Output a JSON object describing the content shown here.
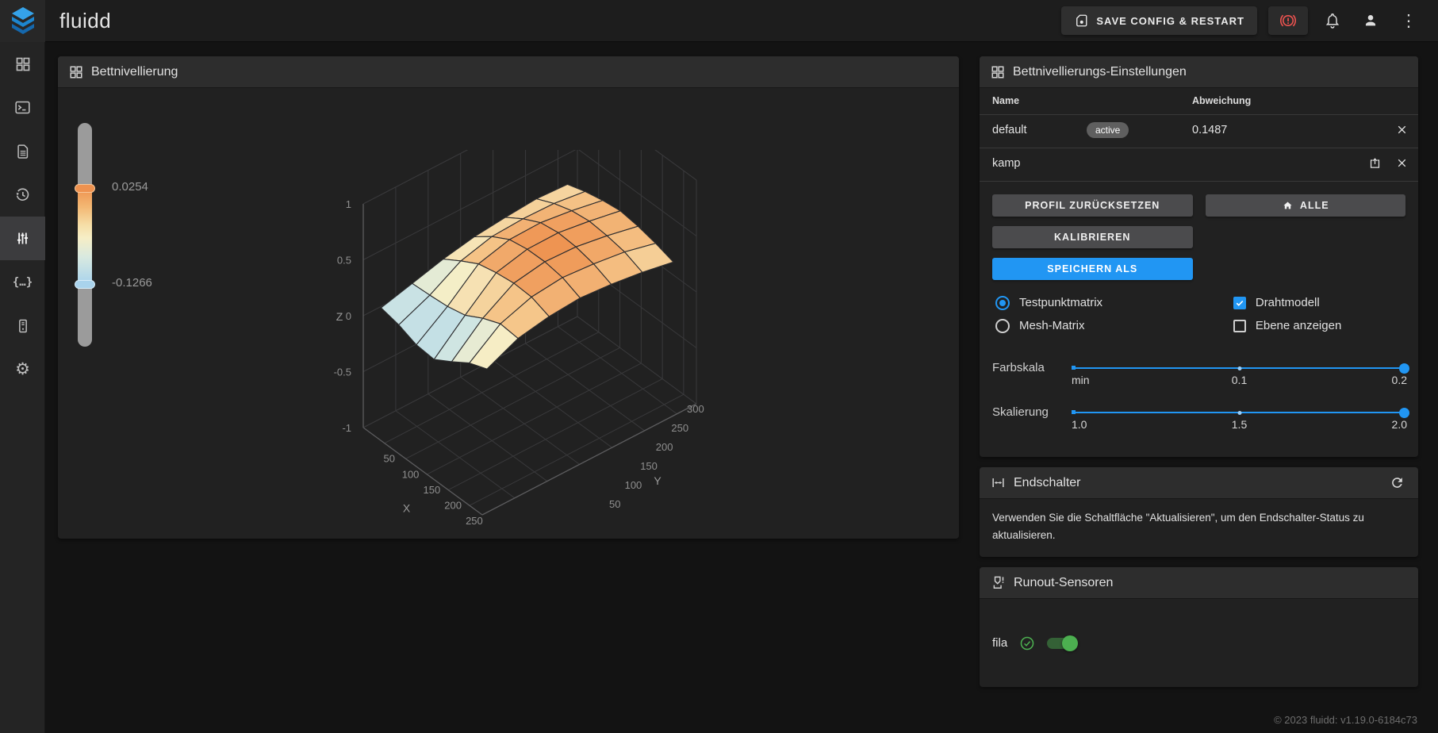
{
  "topbar": {
    "app_title": "fluidd",
    "save_button": "SAVE CONFIG & RESTART"
  },
  "sidebar": {
    "items": [
      {
        "name": "dashboard",
        "active": false
      },
      {
        "name": "console",
        "active": false
      },
      {
        "name": "jobs",
        "active": false
      },
      {
        "name": "history",
        "active": false
      },
      {
        "name": "tune",
        "active": true
      },
      {
        "name": "macros",
        "active": false
      },
      {
        "name": "hardware",
        "active": false
      },
      {
        "name": "settings",
        "active": false
      }
    ]
  },
  "bed_mesh_panel": {
    "title": "Bettnivellierung",
    "colorbar": {
      "max_label": "0.0254",
      "min_label": "-0.1266"
    }
  },
  "chart_data": {
    "type": "surface",
    "title": "bed mesh height map",
    "xlabel": "X",
    "ylabel": "Y",
    "zlabel": "Z",
    "x_range": [
      0,
      280
    ],
    "y_range": [
      0,
      330
    ],
    "z_range": [
      -1,
      1
    ],
    "x_ticks": [
      "50",
      "100",
      "150",
      "200",
      "250"
    ],
    "x_tick_values": [
      50,
      100,
      150,
      200,
      250
    ],
    "y_ticks": [
      "50",
      "100",
      "150",
      "200",
      "250",
      "300"
    ],
    "y_tick_values": [
      50,
      100,
      150,
      200,
      250,
      300
    ],
    "z_ticks": [
      "1",
      "0.5",
      "0",
      "-0.5",
      "-1"
    ],
    "z_tick_values": [
      1,
      0.5,
      0,
      -0.5,
      -1
    ],
    "value_min": -0.1266,
    "value_max": 0.0254,
    "colorscale": [
      [
        0,
        "#a9d3ec"
      ],
      [
        0.38,
        "#d8e9e0"
      ],
      [
        0.56,
        "#f6eec6"
      ],
      [
        0.78,
        "#f5c68a"
      ],
      [
        1,
        "#ee9250"
      ]
    ],
    "mesh_z": [
      [
        -0.095,
        -0.105,
        -0.122,
        -0.126,
        -0.1,
        -0.072,
        -0.055
      ],
      [
        -0.075,
        -0.072,
        -0.068,
        -0.058,
        -0.034,
        -0.016,
        -0.02
      ],
      [
        -0.055,
        -0.028,
        -0.004,
        0.006,
        0.012,
        0.01,
        -0.006
      ],
      [
        -0.04,
        -0.008,
        0.016,
        0.024,
        0.025,
        0.018,
        0.0
      ],
      [
        -0.032,
        -0.004,
        0.018,
        0.025,
        0.022,
        0.012,
        -0.006
      ],
      [
        -0.026,
        -0.006,
        0.008,
        0.014,
        0.01,
        0.002,
        -0.016
      ],
      [
        -0.03,
        -0.016,
        -0.006,
        0.0,
        -0.006,
        -0.016,
        -0.03
      ]
    ]
  },
  "settings_panel": {
    "title": "Bettnivellierungs-Einstellungen",
    "table": {
      "col_name": "Name",
      "col_deviation": "Abweichung",
      "rows": [
        {
          "name": "default",
          "badge": "active",
          "deviation": "0.1487"
        },
        {
          "name": "kamp",
          "badge": "",
          "deviation": ""
        }
      ]
    },
    "buttons": {
      "reset": "PROFIL ZURÜCKSETZEN",
      "home_all": "ALLE",
      "calibrate": "KALIBRIEREN",
      "save_as": "SPEICHERN ALS"
    },
    "radios": [
      {
        "label": "Testpunktmatrix",
        "selected": true
      },
      {
        "label": "Mesh-Matrix",
        "selected": false
      }
    ],
    "checkboxes": [
      {
        "label": "Drahtmodell",
        "checked": true
      },
      {
        "label": "Ebene anzeigen",
        "checked": false
      }
    ],
    "sliders": [
      {
        "label": "Farbskala",
        "tick_min": "min",
        "tick_mid": "0.1",
        "tick_max": "0.2"
      },
      {
        "label": "Skalierung",
        "tick_min": "1.0",
        "tick_mid": "1.5",
        "tick_max": "2.0"
      }
    ]
  },
  "endstops_panel": {
    "title": "Endschalter",
    "description": "Verwenden Sie die Schaltfläche \"Aktualisieren\", um den Endschalter-Status zu aktualisieren."
  },
  "runout_panel": {
    "title": "Runout-Sensoren",
    "sensors": [
      {
        "name": "fila",
        "enabled": true
      }
    ]
  },
  "footer": {
    "version_text": "© 2023 fluidd: v1.19.0-6184c73"
  },
  "colors": {
    "accent_blue": "#2196f3",
    "alert_red": "#ef5350",
    "success_green": "#4caf50",
    "surface_low": "#a9d3ec",
    "surface_high": "#ee9250"
  }
}
